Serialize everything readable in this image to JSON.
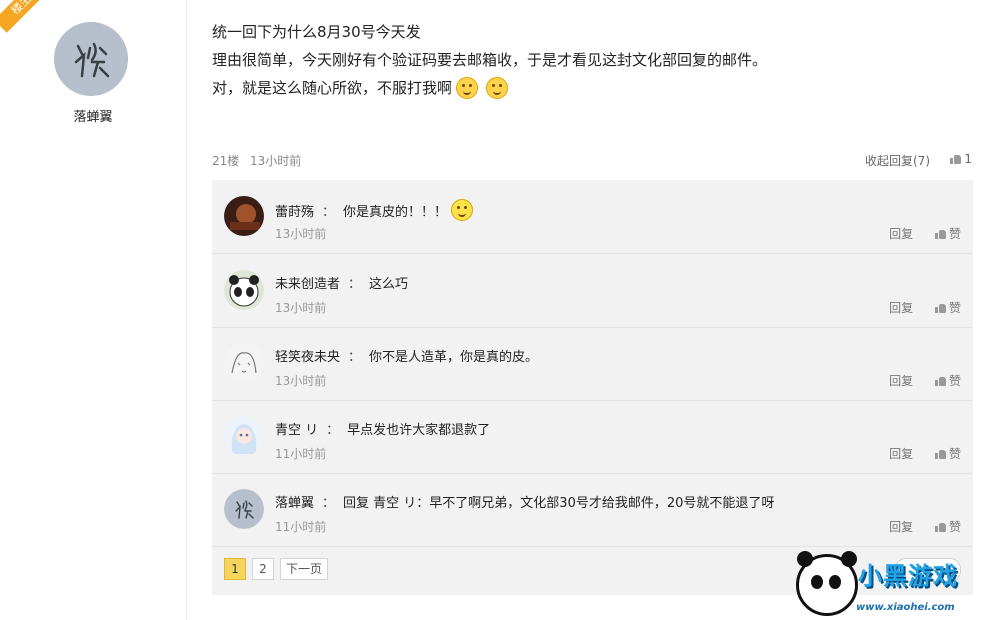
{
  "author": {
    "badge": "楼主",
    "name": "落蝉翼"
  },
  "post": {
    "lines": [
      "统一回下为什么8月30号今天发",
      "理由很简单，今天刚好有个验证码要去邮箱收，于是才看见这封文化部回复的邮件。",
      "对，就是这么随心所欲，不服打我啊"
    ],
    "floor": "21楼",
    "time": "13小时前",
    "collapse_label": "收起回复(7)",
    "like_count": "1"
  },
  "replies": [
    {
      "user": "蕾莳殇",
      "sep": "：",
      "text": "你是真皮的！！！",
      "time": "13小时前",
      "reply_label": "回复",
      "like_label": "赞"
    },
    {
      "user": "未来创造者",
      "sep": "：",
      "text": "这么巧",
      "time": "13小时前",
      "reply_label": "回复",
      "like_label": "赞"
    },
    {
      "user": "轻笑夜未央",
      "sep": "：",
      "text": "你不是人造革，你是真的皮。",
      "time": "13小时前",
      "reply_label": "回复",
      "like_label": "赞"
    },
    {
      "user": "青空 リ",
      "sep": "：",
      "text": "早点发也许大家都退款了",
      "time": "11小时前",
      "reply_label": "回复",
      "like_label": "赞"
    },
    {
      "user": "落蝉翼",
      "sep": "：",
      "text": "回复 青空 リ：早不了啊兄弟，文化部30号才给我邮件，20号就不能退了呀",
      "time": "11小时前",
      "reply_label": "回复",
      "like_label": "赞"
    }
  ],
  "pager": {
    "pages": [
      "1",
      "2"
    ],
    "next_label": "下一页"
  },
  "watermark": {
    "title": "小黑游戏",
    "url": "www.xiaohei.com"
  }
}
